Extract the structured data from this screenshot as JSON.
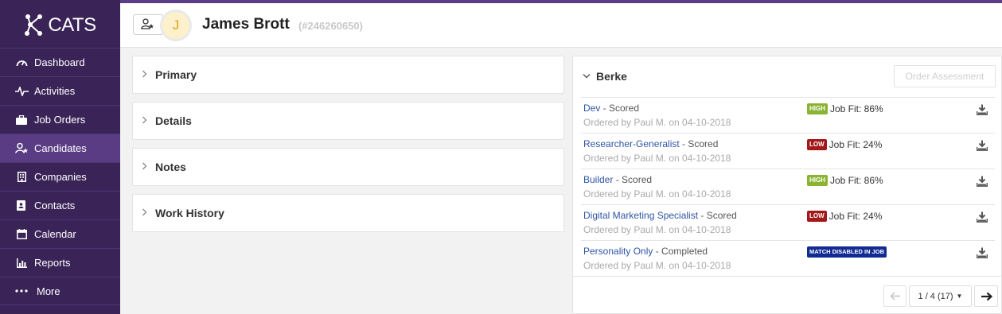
{
  "app": {
    "logo_text": "CATS"
  },
  "sidebar": {
    "items": [
      {
        "label": "Dashboard",
        "icon": "dashboard-icon"
      },
      {
        "label": "Activities",
        "icon": "activity-pulse-icon"
      },
      {
        "label": "Job Orders",
        "icon": "briefcase-icon"
      },
      {
        "label": "Candidates",
        "icon": "user-star-icon",
        "active": true
      },
      {
        "label": "Companies",
        "icon": "building-icon"
      },
      {
        "label": "Contacts",
        "icon": "address-book-icon"
      },
      {
        "label": "Calendar",
        "icon": "calendar-icon"
      },
      {
        "label": "Reports",
        "icon": "bar-chart-icon"
      },
      {
        "label": "More",
        "icon": "ellipsis-icon"
      }
    ]
  },
  "header": {
    "avatar_initial": "J",
    "candidate_name": "James Brott",
    "candidate_id": "(#246260650)"
  },
  "sections": [
    {
      "label": "Primary"
    },
    {
      "label": "Details"
    },
    {
      "label": "Notes"
    },
    {
      "label": "Work History"
    }
  ],
  "assessments": {
    "title": "Berke",
    "order_button": "Order Assessment",
    "rows": [
      {
        "name": "Dev",
        "status": " - Scored",
        "ordered": "Ordered by Paul M. on 04-10-2018",
        "badge": "HIGH",
        "badge_type": "high",
        "fit": "Job Fit: 86%"
      },
      {
        "name": "Researcher-Generalist",
        "status": " - Scored",
        "ordered": "Ordered by Paul M. on 04-10-2018",
        "badge": "LOW",
        "badge_type": "low",
        "fit": "Job Fit: 24%"
      },
      {
        "name": "Builder",
        "status": " - Scored",
        "ordered": "Ordered by Paul M. on 04-10-2018",
        "badge": "HIGH",
        "badge_type": "high",
        "fit": "Job Fit: 86%"
      },
      {
        "name": "Digital Marketing Specialist",
        "status": " - Scored",
        "ordered": "Ordered by Paul M. on 04-10-2018",
        "badge": "LOW",
        "badge_type": "low",
        "fit": "Job Fit: 24%"
      },
      {
        "name": "Personality Only",
        "status": " - Completed",
        "ordered": "Ordered by Paul M. on 04-10-2018",
        "badge": "MATCH DISABLED IN JOB",
        "badge_type": "disabled",
        "fit": ""
      }
    ],
    "pager": {
      "label": "1 / 4 (17)"
    }
  },
  "colors": {
    "sidebar_bg": "#3a2357",
    "sidebar_active": "#5a3c85",
    "top_stripe": "#5b3e86",
    "link": "#2f56a6",
    "badge_high": "#8bb332",
    "badge_low": "#a3191b",
    "badge_disabled": "#122a93"
  }
}
